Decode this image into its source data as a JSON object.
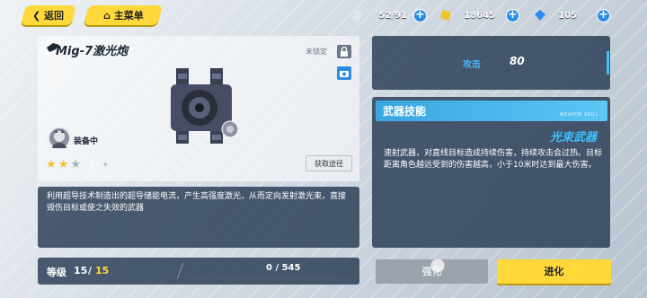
{
  "nav": {
    "back_label": "返回",
    "menu_label": "主菜单"
  },
  "resources": {
    "stamina": {
      "value": "52/91",
      "icon": "stamina-icon"
    },
    "coins": {
      "value": "18645",
      "icon": "coin-icon"
    },
    "crystals": {
      "value": "105",
      "icon": "crystal-icon"
    },
    "plus_symbol": "+"
  },
  "weapon": {
    "name": "Mig-7激光炮",
    "lock_status": "未锁定",
    "equip_status": "装备中",
    "stars": {
      "filled": 2,
      "total": 3
    },
    "star_separator": "/",
    "obtain_label": "获取途径",
    "description": "利用超导技术制造出的超导储能电流，产生高强度激光，从而定向发射激光束，直接毁伤目标或使之失效的武器"
  },
  "stats": {
    "attack_label": "攻击",
    "attack_value": "80"
  },
  "skill": {
    "header": "武器技能",
    "header_sub": "WEAPON SKILL",
    "name": "光束武器",
    "description": "速射武器，对直线目标造成持续伤害，持续攻击会过热。目标距离角色越远受到的伤害越高，小于10米时达到最大伤害。"
  },
  "level": {
    "label": "等级",
    "current": "15",
    "separator": "/",
    "max": "15"
  },
  "exp": {
    "value": "0 / 545",
    "progress": 0
  },
  "actions": {
    "enhance_label": "强化",
    "evolve_label": "进化"
  },
  "colors": {
    "accent_yellow": "#ffd83a",
    "accent_blue": "#3ec0ff",
    "panel_dark": "#1e324b"
  }
}
